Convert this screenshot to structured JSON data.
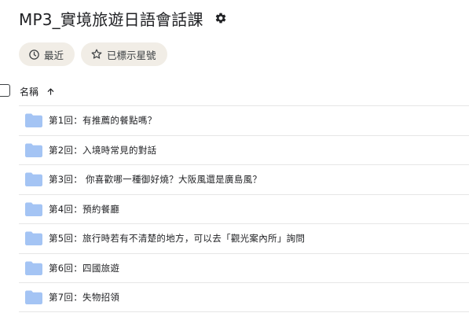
{
  "page": {
    "title": "MP3_實境旅遊日語會話課"
  },
  "chips": {
    "recent_label": "最近",
    "starred_label": "已標示星號"
  },
  "table": {
    "name_header": "名稱"
  },
  "folders": [
    {
      "label": "第1回：有推薦的餐點嗎？"
    },
    {
      "label": "第2回：入境時常見的對話"
    },
    {
      "label": "第3回： 你喜歡哪一種御好燒？大阪風還是廣島風？"
    },
    {
      "label": "第4回：預約餐廳"
    },
    {
      "label": "第5回：旅行時若有不清楚的地方，可以去「觀光案內所」詢問"
    },
    {
      "label": "第6回：四國旅遊"
    },
    {
      "label": "第7回：失物招領"
    }
  ],
  "colors": {
    "chip_bg": "#f1ede6",
    "folder": "#a4c4f4",
    "divider": "#e6e6e6"
  },
  "icons": {
    "settings": "gear-icon",
    "recent": "clock-icon",
    "starred": "star-outline-icon",
    "sort": "arrow-up-icon",
    "folder": "folder-icon"
  }
}
